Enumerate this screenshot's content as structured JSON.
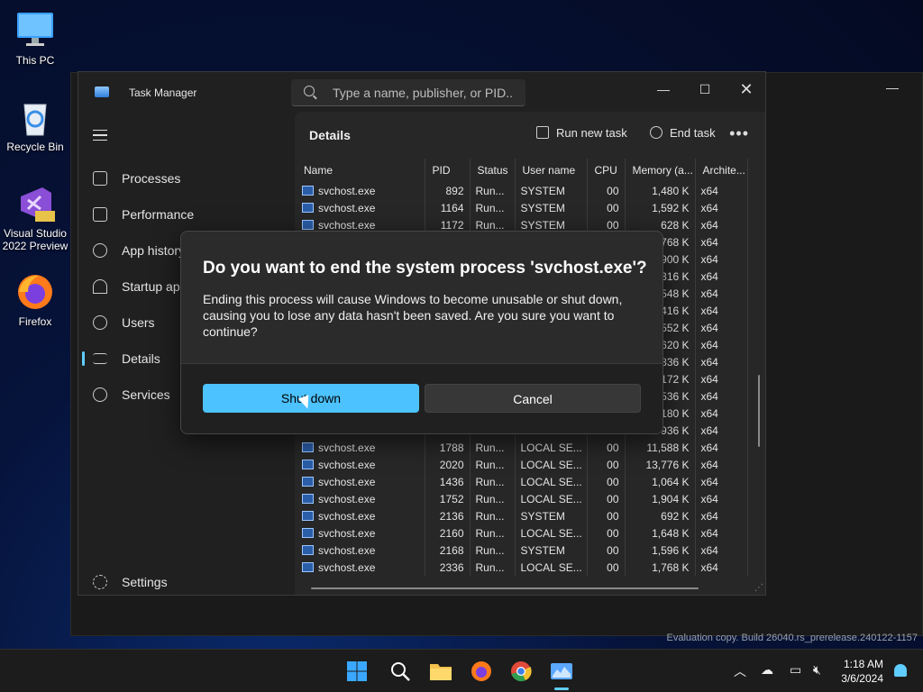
{
  "desktop": {
    "icons": [
      {
        "label": "This PC"
      },
      {
        "label": "Recycle Bin"
      },
      {
        "label": "Visual Studio 2022 Preview"
      },
      {
        "label": "Firefox"
      }
    ]
  },
  "task_manager": {
    "title": "Task Manager",
    "search_placeholder": "Type a name, publisher, or PID...",
    "nav": [
      {
        "label": "Processes",
        "icon": "processes-icon"
      },
      {
        "label": "Performance",
        "icon": "performance-icon"
      },
      {
        "label": "App history",
        "icon": "app-history-icon"
      },
      {
        "label": "Startup apps",
        "icon": "startup-icon"
      },
      {
        "label": "Users",
        "icon": "users-icon"
      },
      {
        "label": "Details",
        "icon": "details-icon"
      },
      {
        "label": "Services",
        "icon": "services-icon"
      }
    ],
    "settings_label": "Settings",
    "page_title": "Details",
    "run_new_task": "Run new task",
    "end_task": "End task",
    "columns": [
      "Name",
      "PID",
      "Status",
      "User name",
      "CPU",
      "Memory (a...",
      "Archite..."
    ],
    "rows": [
      [
        "svchost.exe",
        "892",
        "Run...",
        "SYSTEM",
        "00",
        "1,480 K",
        "x64"
      ],
      [
        "svchost.exe",
        "1164",
        "Run...",
        "SYSTEM",
        "00",
        "1,592 K",
        "x64"
      ],
      [
        "svchost.exe",
        "1172",
        "Run...",
        "SYSTEM",
        "00",
        "628 K",
        "x64"
      ],
      [
        "",
        "",
        "",
        "",
        "",
        "768 K",
        "x64"
      ],
      [
        "",
        "",
        "",
        "",
        "",
        "900 K",
        "x64"
      ],
      [
        "",
        "",
        "",
        "",
        "",
        "316 K",
        "x64"
      ],
      [
        "",
        "",
        "",
        "",
        "",
        "548 K",
        "x64"
      ],
      [
        "",
        "",
        "",
        "",
        "",
        "416 K",
        "x64"
      ],
      [
        "",
        "",
        "",
        "",
        "",
        "552 K",
        "x64"
      ],
      [
        "",
        "",
        "",
        "",
        "",
        "620 K",
        "x64"
      ],
      [
        "",
        "",
        "",
        "",
        "",
        "836 K",
        "x64"
      ],
      [
        "",
        "",
        "",
        "",
        "",
        "172 K",
        "x64"
      ],
      [
        "",
        "",
        "",
        "",
        "",
        "536 K",
        "x64"
      ],
      [
        "",
        "",
        "",
        "",
        "",
        "180 K",
        "x64"
      ],
      [
        "",
        "",
        "",
        "",
        "",
        "936 K",
        "x64"
      ],
      [
        "svchost.exe",
        "1788",
        "Run...",
        "LOCAL SE...",
        "00",
        "11,588 K",
        "x64"
      ],
      [
        "svchost.exe",
        "2020",
        "Run...",
        "LOCAL SE...",
        "00",
        "13,776 K",
        "x64"
      ],
      [
        "svchost.exe",
        "1436",
        "Run...",
        "LOCAL SE...",
        "00",
        "1,064 K",
        "x64"
      ],
      [
        "svchost.exe",
        "1752",
        "Run...",
        "LOCAL SE...",
        "00",
        "1,904 K",
        "x64"
      ],
      [
        "svchost.exe",
        "2136",
        "Run...",
        "SYSTEM",
        "00",
        "692 K",
        "x64"
      ],
      [
        "svchost.exe",
        "2160",
        "Run...",
        "LOCAL SE...",
        "00",
        "1,648 K",
        "x64"
      ],
      [
        "svchost.exe",
        "2168",
        "Run...",
        "SYSTEM",
        "00",
        "1,596 K",
        "x64"
      ],
      [
        "svchost.exe",
        "2336",
        "Run...",
        "LOCAL SE...",
        "00",
        "1,768 K",
        "x64"
      ]
    ]
  },
  "dialog": {
    "title": "Do you want to end the system process 'svchost.exe'?",
    "message": "Ending this process will cause Windows to become unusable or shut down, causing you to lose any data hasn't been saved. Are you sure you want to continue?",
    "primary_label": "Shut down",
    "secondary_label": "Cancel"
  },
  "watermark": "Evaluation copy. Build 26040.rs_prerelease.240122-1157",
  "taskbar": {
    "time": "1:18 AM",
    "date": "3/6/2024"
  },
  "colors": {
    "accent": "#4cc2ff",
    "window_bg": "#202020",
    "dialog_bg": "#2b2b2b"
  }
}
